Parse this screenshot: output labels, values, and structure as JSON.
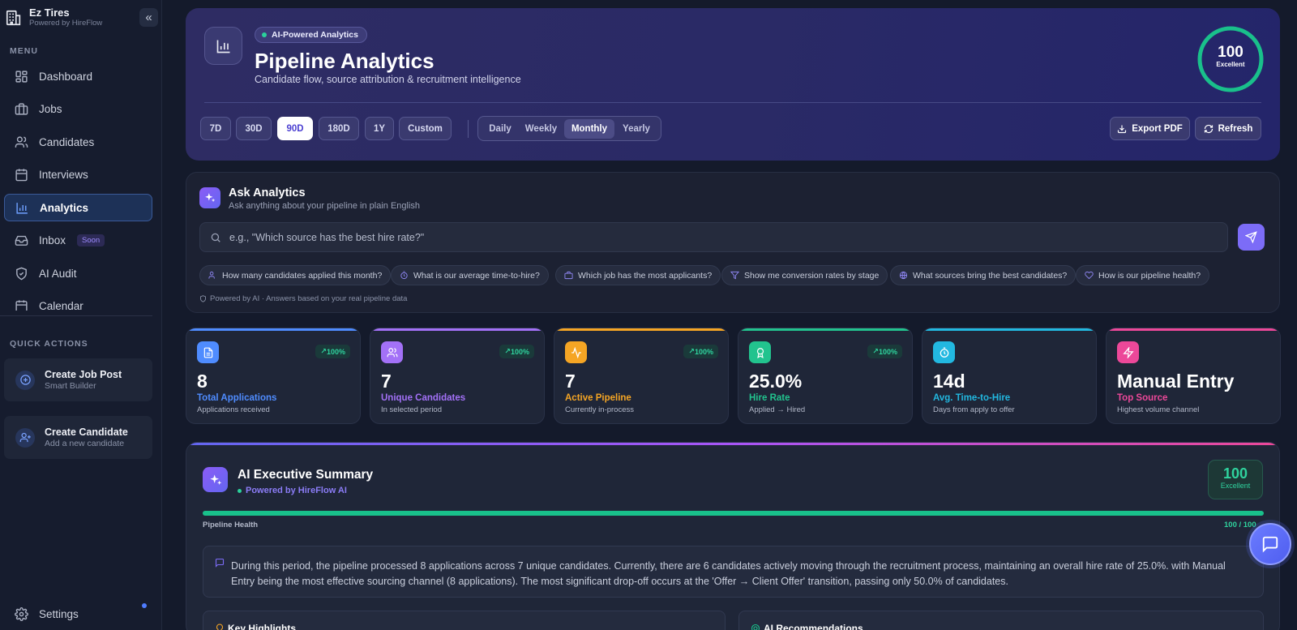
{
  "app": {
    "name": "Ez Tires",
    "subtitle": "Powered by HireFlow"
  },
  "sidebar": {
    "menu_label": "MENU",
    "items": [
      {
        "label": "Dashboard",
        "icon": "dashboard-icon"
      },
      {
        "label": "Jobs",
        "icon": "briefcase-icon"
      },
      {
        "label": "Candidates",
        "icon": "users-icon"
      },
      {
        "label": "Interviews",
        "icon": "calendar-icon"
      },
      {
        "label": "Analytics",
        "icon": "bar-chart-icon",
        "active": true
      },
      {
        "label": "Inbox",
        "icon": "inbox-icon",
        "badge": "Soon"
      },
      {
        "label": "AI Audit",
        "icon": "shield-icon"
      },
      {
        "label": "Calendar",
        "icon": "calendar-icon"
      }
    ],
    "quick_actions_label": "QUICK ACTIONS",
    "quick_actions": [
      {
        "title": "Create Job Post",
        "subtitle": "Smart Builder"
      },
      {
        "title": "Create Candidate",
        "subtitle": "Add a new candidate"
      }
    ],
    "settings_label": "Settings"
  },
  "hero": {
    "badge": "AI-Powered Analytics",
    "title": "Pipeline Analytics",
    "subtitle": "Candidate flow, source attribution & recruitment intelligence",
    "score": "100",
    "score_label": "Excellent",
    "ranges": [
      "7D",
      "30D",
      "90D",
      "180D",
      "1Y",
      "Custom"
    ],
    "selected_range": "90D",
    "periods": [
      "Daily",
      "Weekly",
      "Monthly",
      "Yearly"
    ],
    "selected_period": "Monthly",
    "export_label": "Export PDF",
    "refresh_label": "Refresh"
  },
  "ask": {
    "title": "Ask Analytics",
    "subtitle": "Ask anything about your pipeline in plain English",
    "placeholder": "e.g., \"Which source has the best hire rate?\"",
    "chips": [
      "How many candidates applied this month?",
      "What is our average time-to-hire?",
      "Which job has the most applicants?",
      "Show me conversion rates by stage",
      "What sources bring the best candidates?",
      "How is our pipeline health?"
    ],
    "powered": "Powered by AI · Answers based on your real pipeline data"
  },
  "stats": [
    {
      "value": "8",
      "label": "Total Applications",
      "desc": "Applications received",
      "trend": "100%",
      "color": "#4f8cff"
    },
    {
      "value": "7",
      "label": "Unique Candidates",
      "desc": "In selected period",
      "trend": "100%",
      "color": "#a371f7"
    },
    {
      "value": "7",
      "label": "Active Pipeline",
      "desc": "Currently in-process",
      "trend": "100%",
      "color": "#f5a524"
    },
    {
      "value": "25.0%",
      "label": "Hire Rate",
      "desc": "Applied → Hired",
      "trend": "100%",
      "color": "#22c38e"
    },
    {
      "value": "14d",
      "label": "Avg. Time-to-Hire",
      "desc": "Days from apply to offer",
      "color": "#22b8e0"
    },
    {
      "value": "Manual Entry",
      "label": "Top Source",
      "desc": "Highest volume channel",
      "color": "#ec4899"
    }
  ],
  "executive": {
    "title": "AI Executive Summary",
    "subtitle": "Powered by HireFlow AI",
    "score": "100",
    "score_label": "Excellent",
    "health_label": "Pipeline Health",
    "health_value": "100 / 100",
    "health_fraction": 1.0,
    "summary": "During this period, the pipeline processed 8 applications across 7 unique candidates. Currently, there are 6 candidates actively moving through the recruitment process, maintaining an overall hire rate of 25.0%. with Manual Entry being the most effective sourcing channel (8 applications). The most significant drop-off occurs at the 'Offer → Client Offer' transition, passing only 50.0% of candidates.",
    "highlights_title": "Key Highlights",
    "recommendations_title": "AI Recommendations"
  }
}
